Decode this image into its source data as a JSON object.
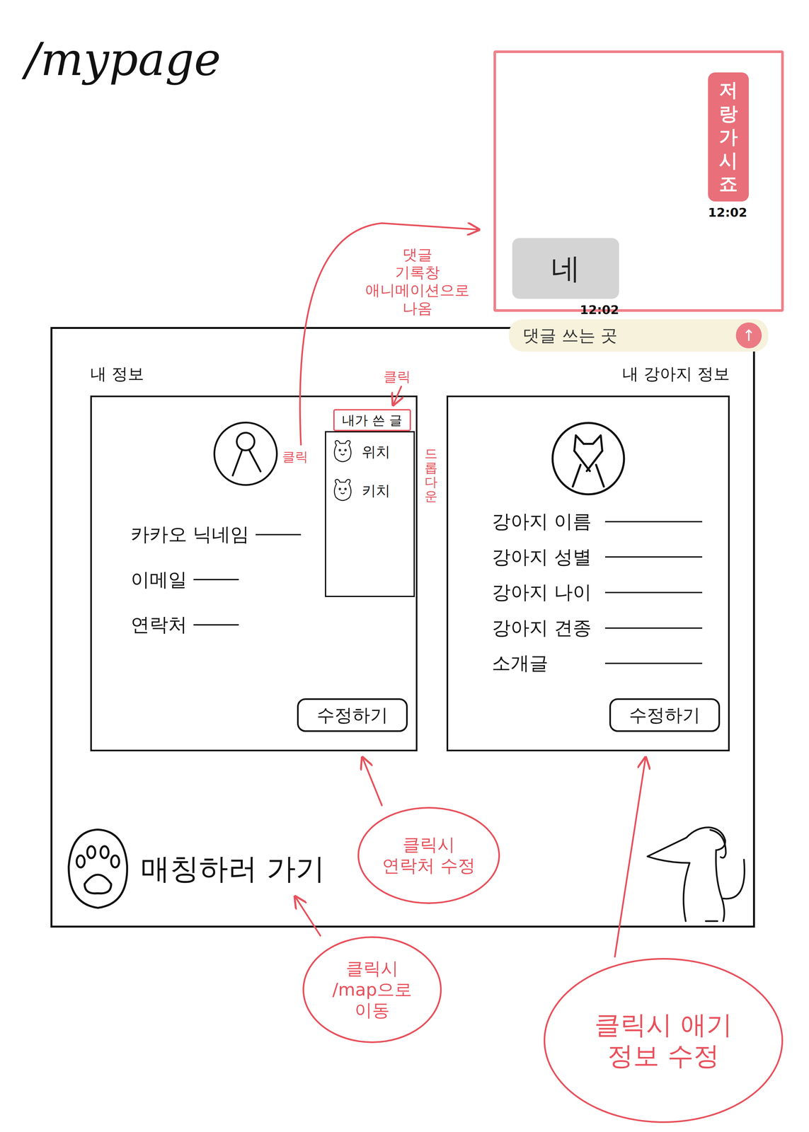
{
  "page": {
    "title": "/mypage"
  },
  "chat": {
    "messages": [
      {
        "text": "저랑 가시죠",
        "time": "12:02",
        "kind": "sent"
      },
      {
        "text": "네",
        "time": "12:02",
        "kind": "received"
      }
    ],
    "input": {
      "placeholder": "댓글 쓰는 곳"
    },
    "send": {
      "label": "↑"
    }
  },
  "profile": {
    "heading": "내 정보",
    "fields": [
      {
        "label": "카카오 닉네임"
      },
      {
        "label": "이메일"
      },
      {
        "label": "연락처"
      }
    ],
    "edit_button": "수정하기",
    "posts_menu": {
      "label": "내가 쓴 글",
      "expanded": true,
      "items": [
        {
          "author": "위치"
        },
        {
          "author": "키치"
        }
      ]
    }
  },
  "dog": {
    "heading": "내 강아지 정보",
    "fields": [
      {
        "label": "강아지 이름"
      },
      {
        "label": "강아지 성별"
      },
      {
        "label": "강아지 나이"
      },
      {
        "label": "강아지 견종"
      },
      {
        "label": "소개글"
      }
    ],
    "edit_button": "수정하기"
  },
  "matching": {
    "label": "매칭하러 가기"
  },
  "annotations": {
    "chat_panel": {
      "lines": [
        "댓글",
        "기록창",
        "애니메이션으로",
        "나옴"
      ]
    },
    "posts_click": {
      "lines": [
        "클릭"
      ]
    },
    "item_click": {
      "lines": [
        "클릭"
      ]
    },
    "dropdown": {
      "lines": [
        "드롭다운"
      ]
    },
    "edit_contact": {
      "lines": [
        "클릭시",
        "연락처 수정"
      ]
    },
    "go_map": {
      "lines": [
        "클릭시",
        "/map으로",
        "이동"
      ]
    },
    "edit_dog": {
      "lines": [
        "클릭시 애기",
        "정보 수정"
      ]
    }
  }
}
